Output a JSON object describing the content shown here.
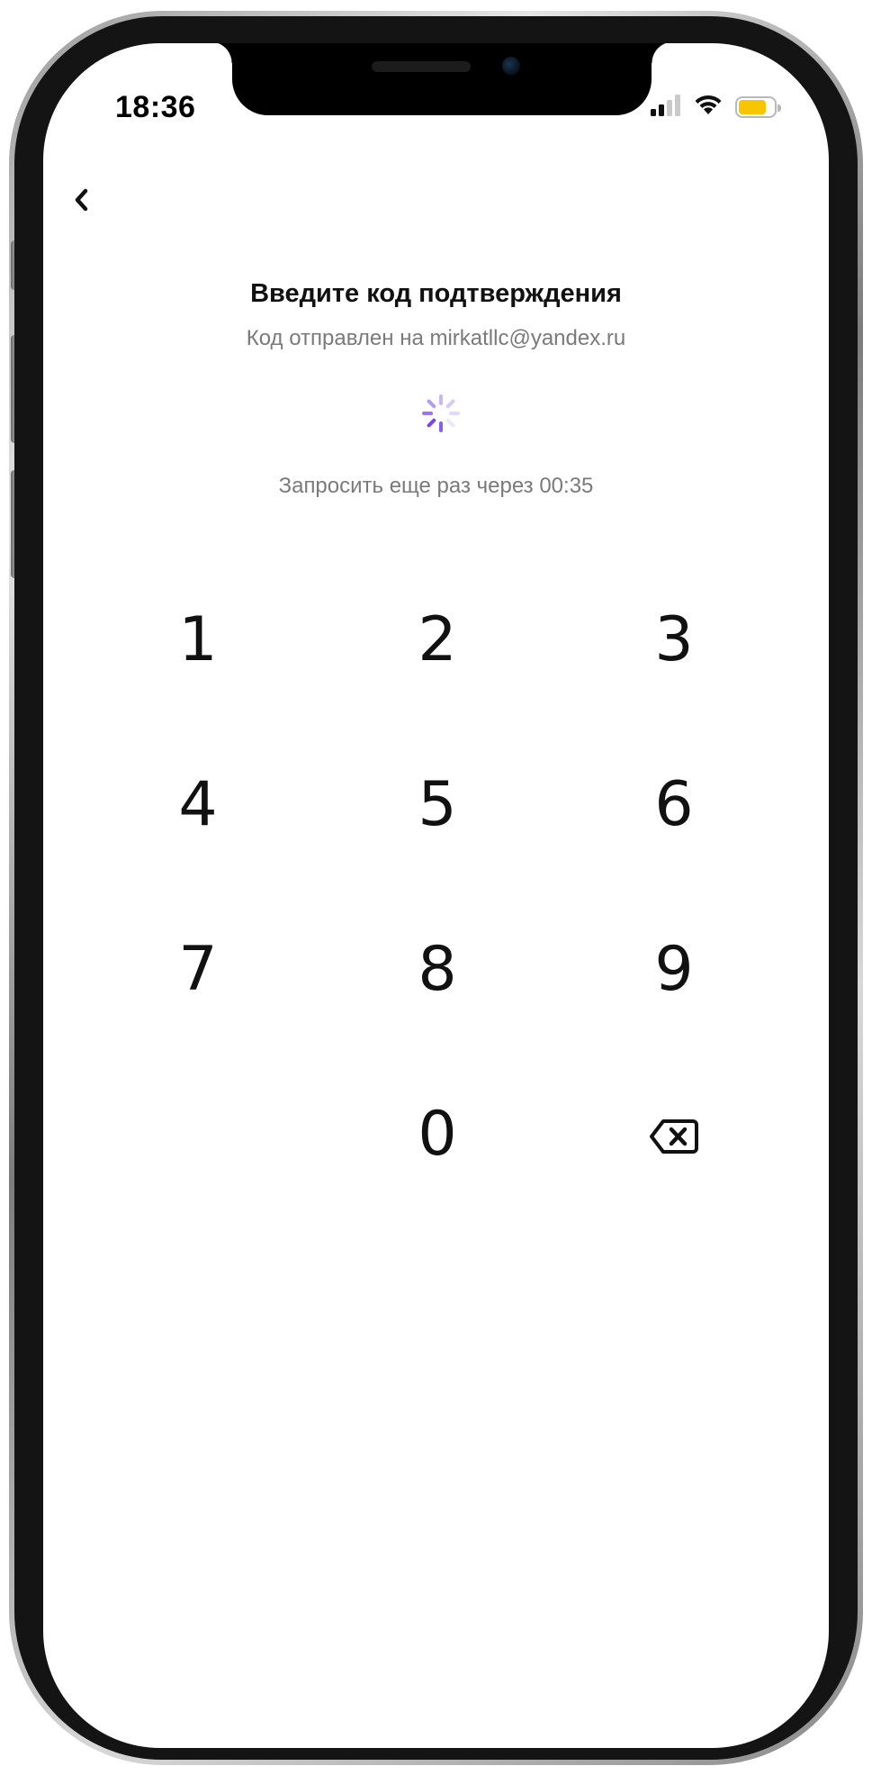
{
  "status_bar": {
    "time": "18:36",
    "icons": [
      "signal-icon",
      "wifi-icon",
      "battery-icon"
    ],
    "battery_color": "#f7c600"
  },
  "header": {
    "back_icon": "chevron-left-icon"
  },
  "content": {
    "title": "Введите код подтверждения",
    "subtitle": "Код отправлен на mirkatllc@yandex.ru",
    "loading_icon": "spinner-icon",
    "resend_text": "Запросить еще раз через 00:35"
  },
  "keypad": {
    "keys": [
      "1",
      "2",
      "3",
      "4",
      "5",
      "6",
      "7",
      "8",
      "9",
      "0"
    ],
    "delete_icon": "backspace-icon"
  },
  "colors": {
    "accent": "#8a5cf0",
    "text_primary": "#111111",
    "text_secondary": "#7a7a7a"
  }
}
